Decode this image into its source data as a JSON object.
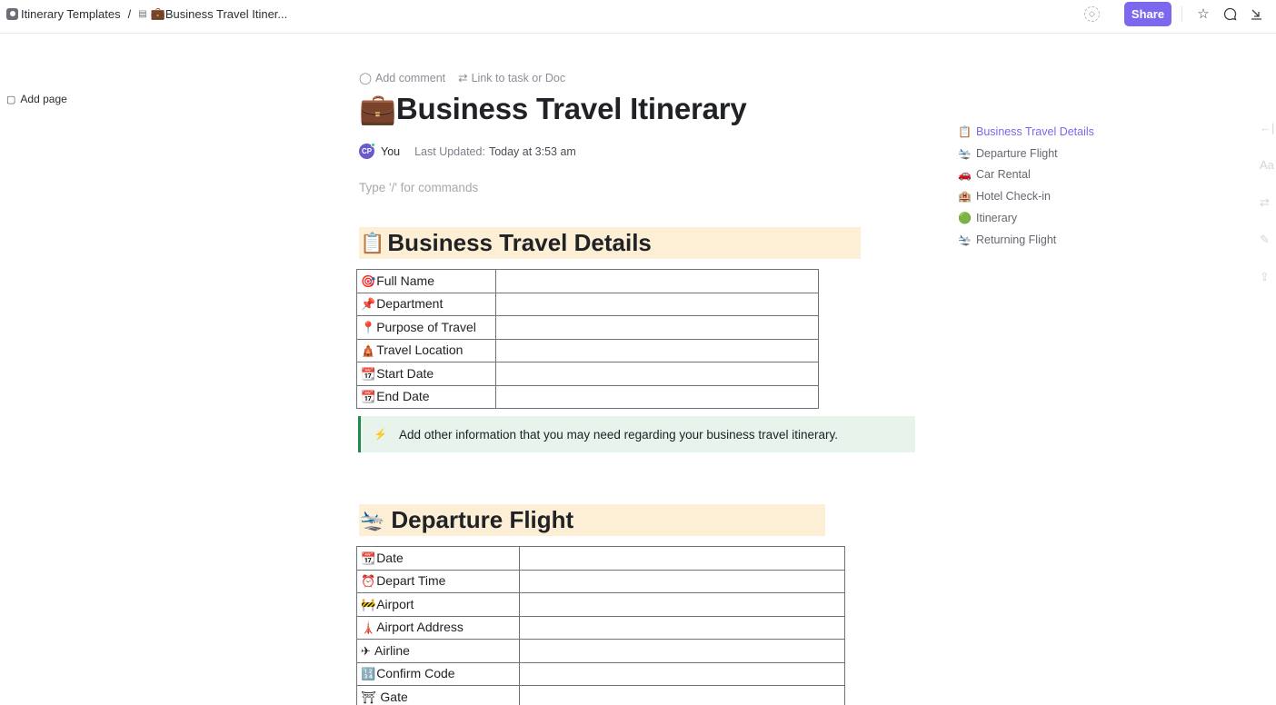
{
  "topbar": {
    "breadcrumb": {
      "space": "Itinerary Templates",
      "separator": "/",
      "doc_emoji": "💼",
      "doc": "Business Travel Itiner..."
    },
    "share_label": "Share",
    "icons": [
      "ai-tag-icon",
      "star-icon",
      "comment-icon",
      "collapse-icon"
    ]
  },
  "sidebar": {
    "add_page_label": "Add page"
  },
  "doc": {
    "actions": {
      "add_comment": "Add comment",
      "link_task": "Link to task or Doc"
    },
    "title_emoji": "💼",
    "title": "Business Travel Itinerary",
    "author": {
      "initials": "CP",
      "name": "You"
    },
    "last_updated_label": "Last Updated:",
    "last_updated_value": "Today at 3:53 am",
    "command_hint": "Type '/' for commands",
    "sections": [
      {
        "emoji": "📋",
        "heading": "Business Travel Details",
        "rows": [
          {
            "emoji": "🎯",
            "label": "Full Name",
            "value": ""
          },
          {
            "emoji": "📌",
            "label": "Department",
            "value": ""
          },
          {
            "emoji": "📍",
            "label": "Purpose of Travel",
            "value": ""
          },
          {
            "emoji": "🛕",
            "label": "Travel Location",
            "value": ""
          },
          {
            "emoji": "📆",
            "label": "Start Date",
            "value": ""
          },
          {
            "emoji": "📆",
            "label": "End Date",
            "value": ""
          }
        ],
        "callout": {
          "icon": "⚡",
          "text": "Add other information that you may need regarding your business travel itinerary."
        }
      },
      {
        "emoji": "🛬",
        "heading": "Departure Flight",
        "rows": [
          {
            "emoji": "📆",
            "label": "Date",
            "value": ""
          },
          {
            "emoji": "⏰",
            "label": "Depart Time",
            "value": ""
          },
          {
            "emoji": "🚧",
            "label": "Airport",
            "value": ""
          },
          {
            "emoji": "🗼",
            "label": "Airport Address",
            "value": ""
          },
          {
            "emoji": "✈",
            "label": "Airline",
            "value": ""
          },
          {
            "emoji": "🔢",
            "label": "Confirm Code",
            "value": ""
          },
          {
            "emoji": "⛩",
            "label": "Gate",
            "value": ""
          }
        ]
      }
    ]
  },
  "toc": {
    "active_color": "#7b68ee",
    "items": [
      {
        "emoji": "📋",
        "label": "Business Travel Details",
        "active": true
      },
      {
        "emoji": "🛬",
        "label": "Departure Flight"
      },
      {
        "emoji": "🚗",
        "label": "Car Rental"
      },
      {
        "emoji": "🏨",
        "label": "Hotel Check-in"
      },
      {
        "emoji": "🟢",
        "label": "Itinerary"
      },
      {
        "emoji": "🛬",
        "label": "Returning Flight"
      }
    ]
  },
  "rail": {
    "icons": [
      "collapse-left-icon",
      "typography-icon",
      "link-icon",
      "magic-wand-icon",
      "export-icon"
    ],
    "typography_label": "Aa"
  }
}
